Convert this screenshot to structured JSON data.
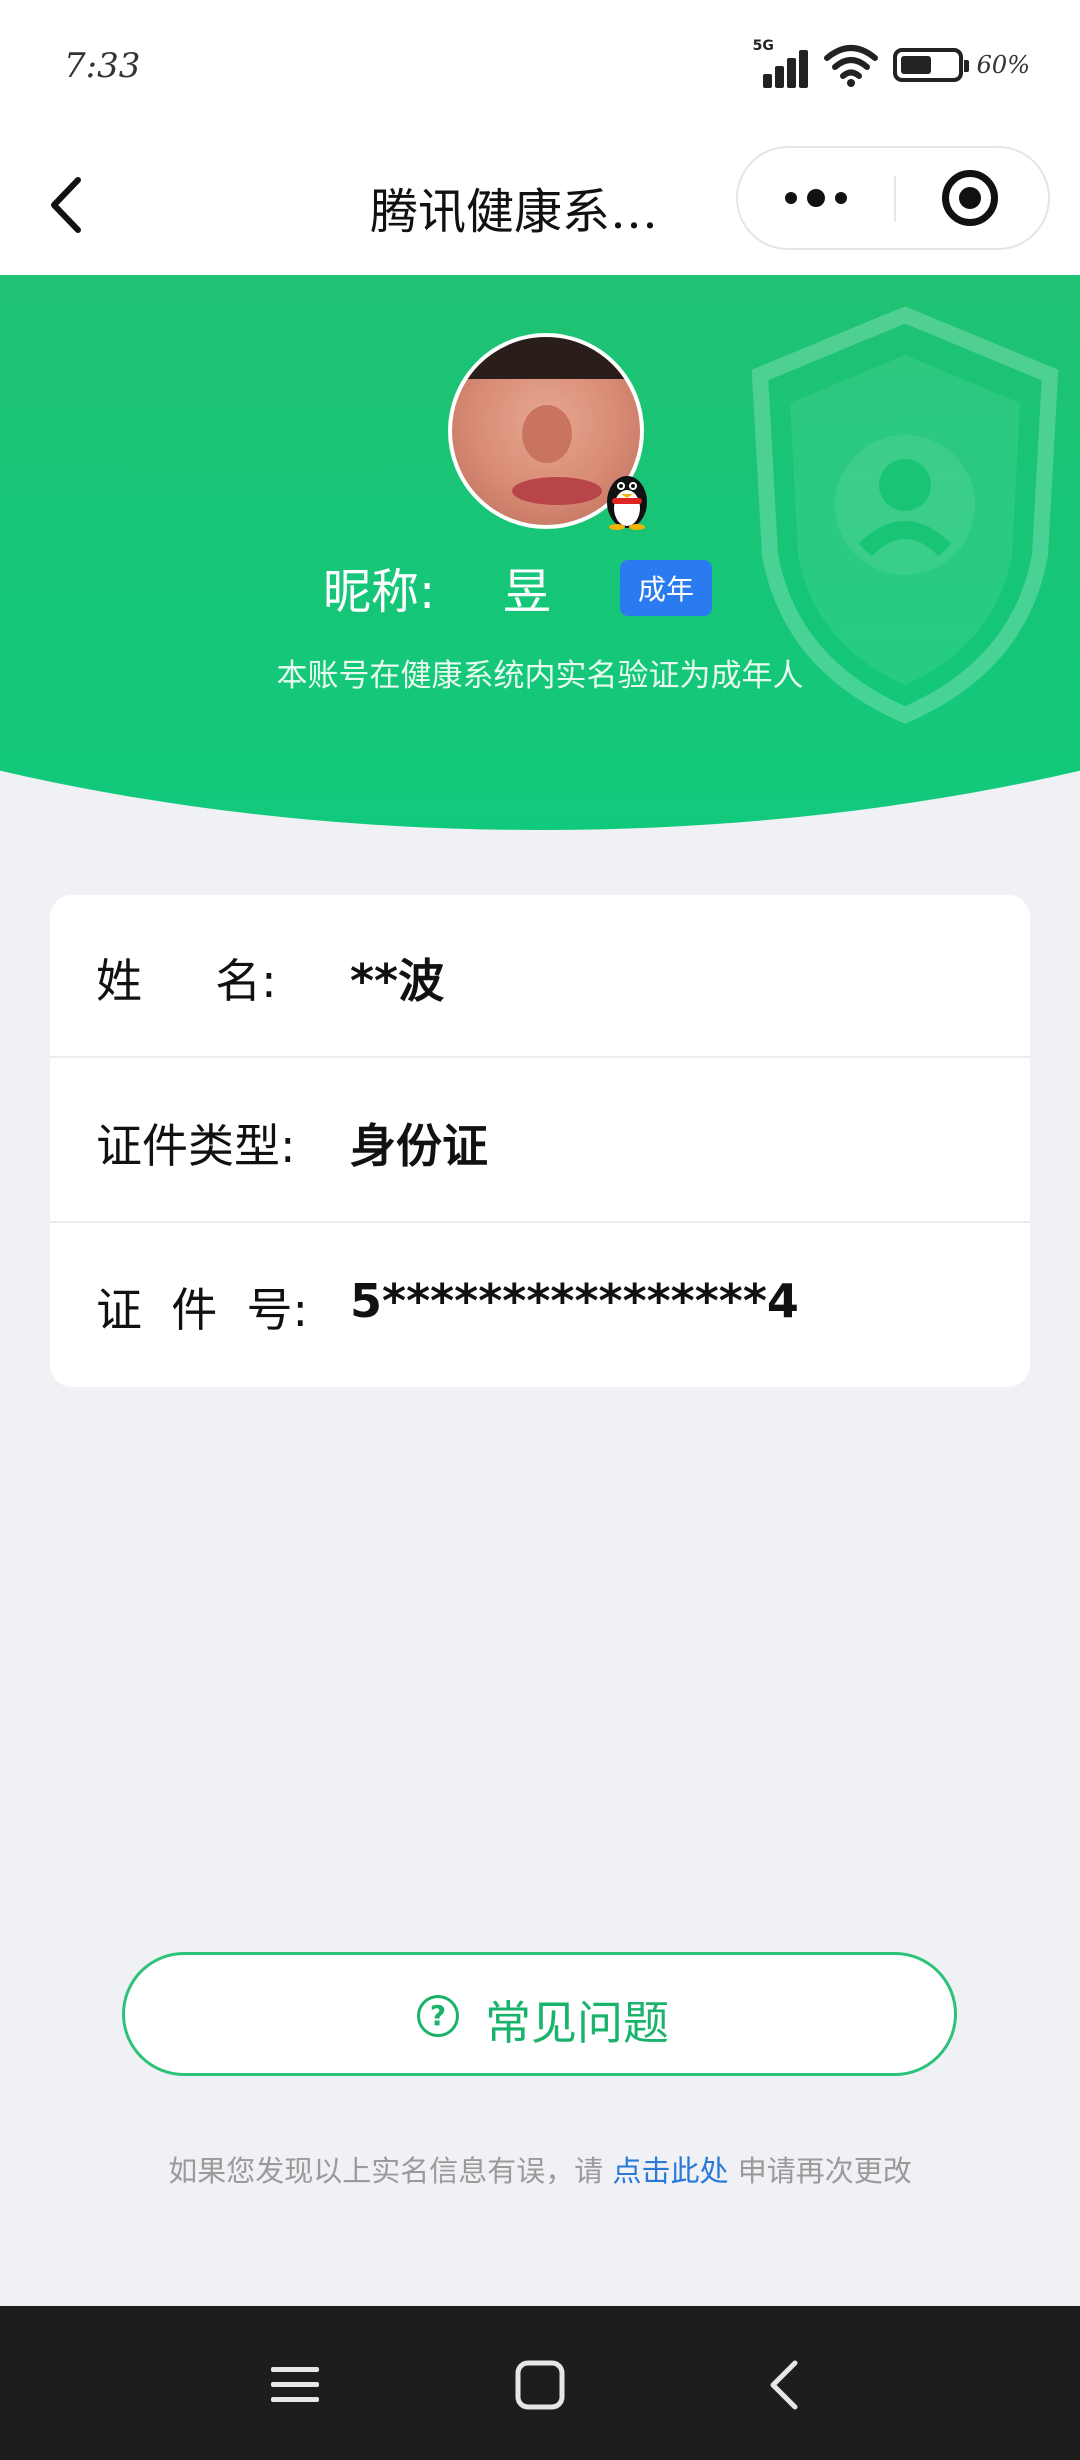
{
  "status_bar": {
    "time": "7:33",
    "network": "5G",
    "battery_percent": "60%",
    "battery_level": 0.6
  },
  "nav": {
    "title": "腾讯健康系…",
    "icons": [
      "back-chevron-icon",
      "more-dots-icon",
      "close-ring-icon"
    ]
  },
  "profile": {
    "nickname_label": "昵称:",
    "nickname_value": "昱",
    "badge": "成年",
    "verify_text": "本账号在健康系统内实名验证为成年人"
  },
  "info": {
    "rows": [
      {
        "label": "姓     名:",
        "value": "**波"
      },
      {
        "label": "证件类型:",
        "value": "身份证"
      },
      {
        "label": "证  件  号:",
        "value": "5****************4"
      }
    ]
  },
  "faq": {
    "label": "常见问题",
    "icon": "question-circle-icon"
  },
  "footer": {
    "prefix": "如果您发现以上实名信息有误，请",
    "link": "点击此处",
    "suffix": "申请再次更改"
  },
  "colors": {
    "brand_green": "#1fc272",
    "badge_blue": "#2a7bf0",
    "link_blue": "#2a78d8",
    "page_background": "#f0f1f4"
  }
}
